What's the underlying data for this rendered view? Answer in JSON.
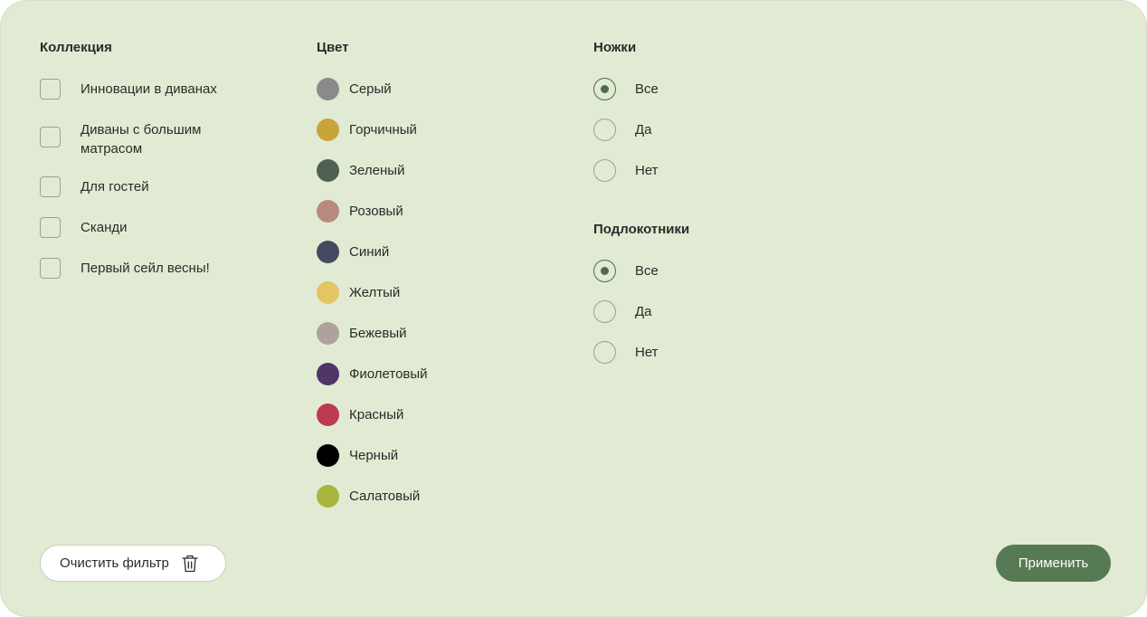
{
  "collection": {
    "title": "Коллекция",
    "items": [
      {
        "label": "Инновации в диванах",
        "checked": false
      },
      {
        "label": "Диваны с большим матрасом",
        "checked": false
      },
      {
        "label": "Для гостей",
        "checked": false
      },
      {
        "label": "Сканди",
        "checked": false
      },
      {
        "label": "Первый сейл весны!",
        "checked": false
      }
    ]
  },
  "color": {
    "title": "Цвет",
    "items": [
      {
        "label": "Серый",
        "hex": "#8a8a8a"
      },
      {
        "label": "Горчичный",
        "hex": "#c9a43b"
      },
      {
        "label": "Зеленый",
        "hex": "#4e6150"
      },
      {
        "label": "Розовый",
        "hex": "#b98a80"
      },
      {
        "label": "Синий",
        "hex": "#444a5f"
      },
      {
        "label": "Желтый",
        "hex": "#e4c465"
      },
      {
        "label": "Бежевый",
        "hex": "#ada39c"
      },
      {
        "label": "Фиолетовый",
        "hex": "#4f3668"
      },
      {
        "label": "Красный",
        "hex": "#bd3a4f"
      },
      {
        "label": "Черный",
        "hex": "#000000"
      },
      {
        "label": "Салатовый",
        "hex": "#a9b53d"
      }
    ]
  },
  "legs": {
    "title": "Ножки",
    "options": [
      {
        "label": "Все",
        "selected": true
      },
      {
        "label": "Да",
        "selected": false
      },
      {
        "label": "Нет",
        "selected": false
      }
    ]
  },
  "armrests": {
    "title": "Подлокотники",
    "options": [
      {
        "label": "Все",
        "selected": true
      },
      {
        "label": "Да",
        "selected": false
      },
      {
        "label": "Нет",
        "selected": false
      }
    ]
  },
  "actions": {
    "clear_label": "Очистить фильтр",
    "clear_icon": "trash-icon",
    "apply_label": "Применить",
    "apply_color": "#567a54"
  }
}
